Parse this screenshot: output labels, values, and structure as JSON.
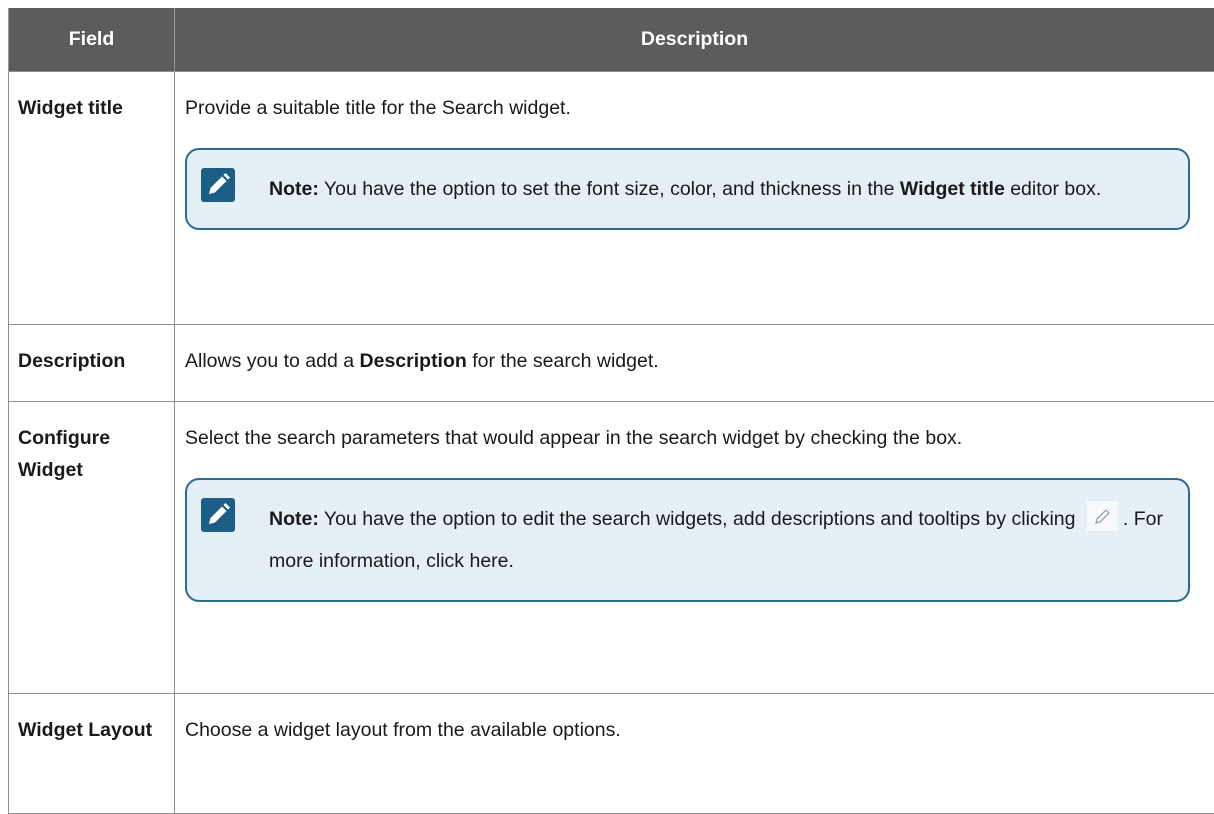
{
  "table": {
    "headers": {
      "field": "Field",
      "description": "Description"
    },
    "rows": [
      {
        "field": "Widget title",
        "description": "Provide a suitable title for the Search widget.",
        "note": {
          "label": "Note:",
          "text_before": " You have the option to set the font size, color, and thickness in the ",
          "bold": "Widget title",
          "text_after": " editor box."
        }
      },
      {
        "field": "Description",
        "description_before": "Allows you to add a ",
        "description_bold": "Description",
        "description_after": " for the search widget."
      },
      {
        "field": "Configure Widget",
        "description": "Select the search parameters that would appear in the search widget by checking the box.",
        "note": {
          "label": "Note:",
          "text_before": " You have the option to edit the search widgets, add descriptions and tooltips by clicking ",
          "icon": "pencil-icon",
          "text_after": ". For more information, click here."
        }
      },
      {
        "field": "Widget Layout",
        "description": "Choose a widget layout from the available options."
      }
    ]
  },
  "colors": {
    "header_bg": "#5c5c5c",
    "note_border": "#2f6b8a",
    "note_bg": "#e4eff6",
    "note_icon_bg": "#1d5e86"
  }
}
